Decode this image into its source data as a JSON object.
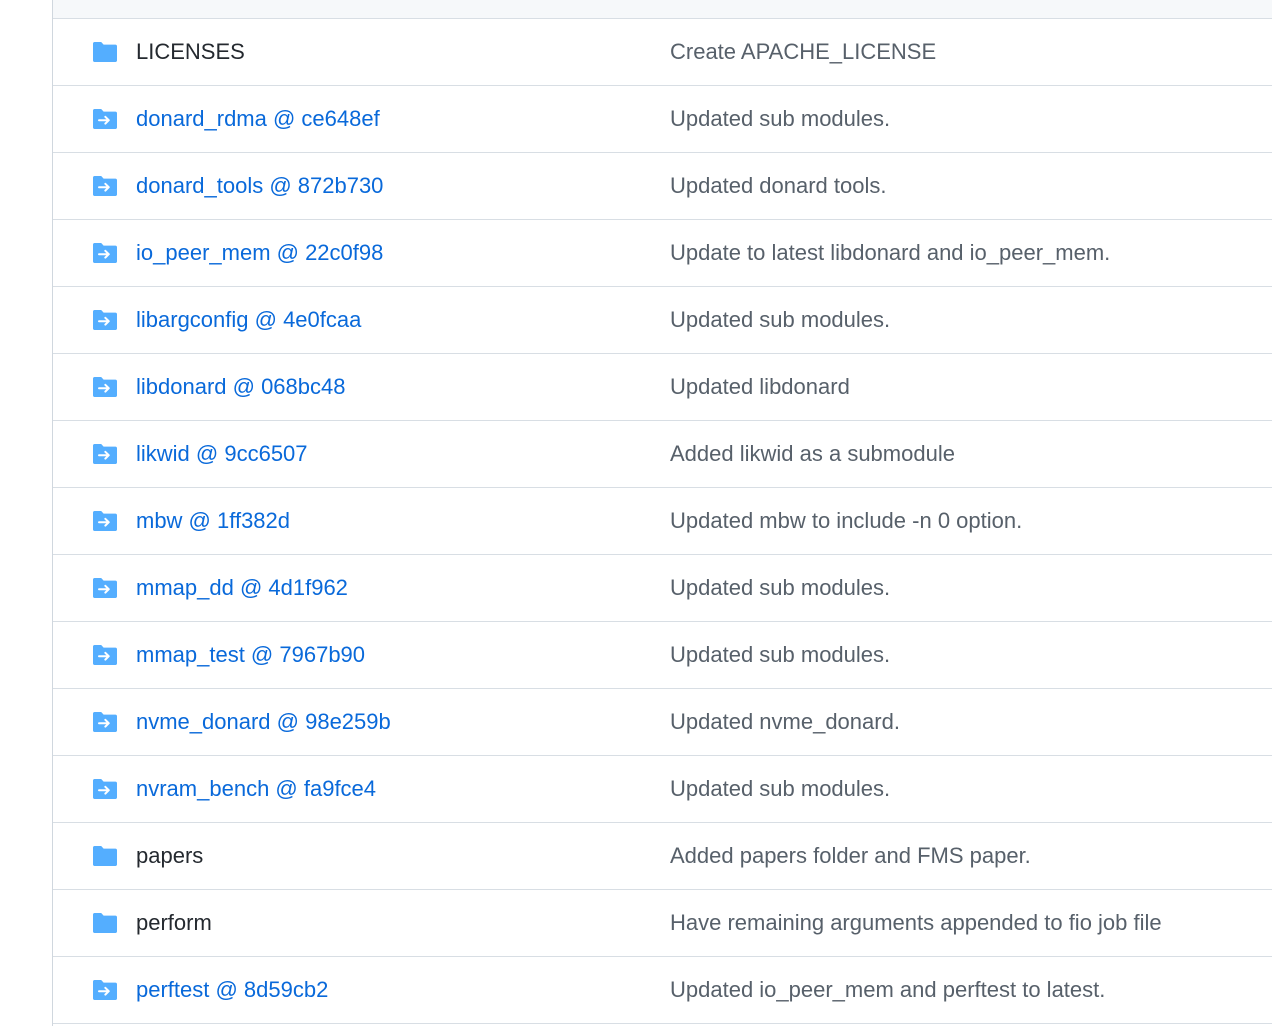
{
  "colors": {
    "folder_icon": "#54aeff",
    "link": "#0969da",
    "text": "#24292f",
    "muted": "#57606a",
    "border": "#d8dee4"
  },
  "files": [
    {
      "type": "directory",
      "icon": "folder-icon",
      "name": "LICENSES",
      "commit_message": "Create APACHE_LICENSE"
    },
    {
      "type": "submodule",
      "icon": "submodule-folder-icon",
      "name": "donard_rdma @ ce648ef",
      "commit_message": "Updated sub modules."
    },
    {
      "type": "submodule",
      "icon": "submodule-folder-icon",
      "name": "donard_tools @ 872b730",
      "commit_message": "Updated donard tools."
    },
    {
      "type": "submodule",
      "icon": "submodule-folder-icon",
      "name": "io_peer_mem @ 22c0f98",
      "commit_message": "Update to latest libdonard and io_peer_mem."
    },
    {
      "type": "submodule",
      "icon": "submodule-folder-icon",
      "name": "libargconfig @ 4e0fcaa",
      "commit_message": "Updated sub modules."
    },
    {
      "type": "submodule",
      "icon": "submodule-folder-icon",
      "name": "libdonard @ 068bc48",
      "commit_message": "Updated libdonard"
    },
    {
      "type": "submodule",
      "icon": "submodule-folder-icon",
      "name": "likwid @ 9cc6507",
      "commit_message": "Added likwid as a submodule"
    },
    {
      "type": "submodule",
      "icon": "submodule-folder-icon",
      "name": "mbw @ 1ff382d",
      "commit_message": "Updated mbw to include -n 0 option."
    },
    {
      "type": "submodule",
      "icon": "submodule-folder-icon",
      "name": "mmap_dd @ 4d1f962",
      "commit_message": "Updated sub modules."
    },
    {
      "type": "submodule",
      "icon": "submodule-folder-icon",
      "name": "mmap_test @ 7967b90",
      "commit_message": "Updated sub modules."
    },
    {
      "type": "submodule",
      "icon": "submodule-folder-icon",
      "name": "nvme_donard @ 98e259b",
      "commit_message": "Updated nvme_donard."
    },
    {
      "type": "submodule",
      "icon": "submodule-folder-icon",
      "name": "nvram_bench @ fa9fce4",
      "commit_message": "Updated sub modules."
    },
    {
      "type": "directory",
      "icon": "folder-icon",
      "name": "papers",
      "commit_message": "Added papers folder and FMS paper."
    },
    {
      "type": "directory",
      "icon": "folder-icon",
      "name": "perform",
      "commit_message": "Have remaining arguments appended to fio job file"
    },
    {
      "type": "submodule",
      "icon": "submodule-folder-icon",
      "name": "perftest @ 8d59cb2",
      "commit_message": "Updated io_peer_mem and perftest to latest."
    }
  ]
}
